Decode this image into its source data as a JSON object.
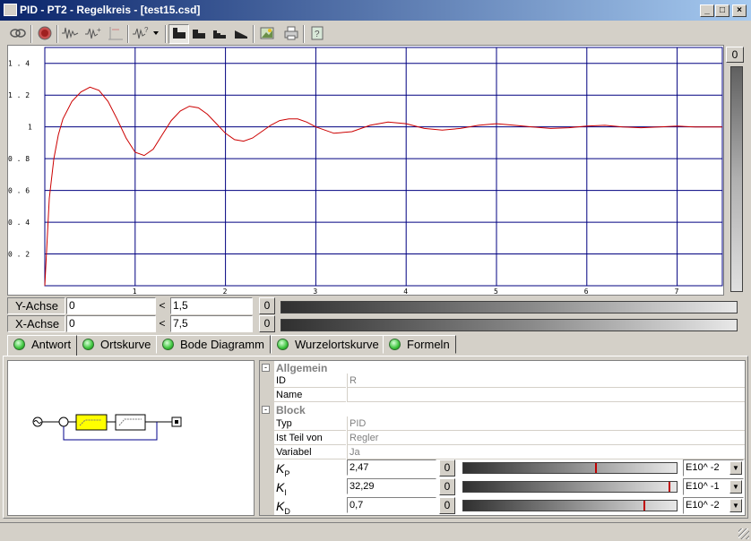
{
  "window": {
    "title": "PID - PT2 - Regelkreis - [test15.csd]",
    "buttons": [
      "_",
      "□",
      "×"
    ]
  },
  "toolbar": {
    "icons": [
      "link-icon",
      "record-icon",
      "signal-icon",
      "signal-add-icon",
      "marker-icon",
      "signal-select-icon",
      "step-1-icon",
      "step-2-icon",
      "step-3-icon",
      "step-4-icon",
      "image-icon",
      "print-icon",
      "help-icon"
    ]
  },
  "chart_data": {
    "type": "line",
    "title": "",
    "xlabel": "",
    "ylabel": "",
    "xlim": [
      0,
      7.5
    ],
    "ylim": [
      0,
      1.5
    ],
    "x_ticks": [
      "1",
      "2",
      "3",
      "4",
      "5",
      "6",
      "7"
    ],
    "y_ticks": [
      "0.2",
      "0.4",
      "0.6",
      "0.8",
      "1",
      "1.2",
      "1.4"
    ],
    "y_tick_labels": [
      "0 . 2",
      "0 . 4",
      "0 . 6",
      "0 . 8",
      "1",
      "1 . 2",
      "1 . 4"
    ],
    "grid": true,
    "series": [
      {
        "color": "#cc0000",
        "x": [
          0,
          0.05,
          0.1,
          0.15,
          0.2,
          0.3,
          0.4,
          0.5,
          0.6,
          0.7,
          0.8,
          0.9,
          1.0,
          1.1,
          1.2,
          1.3,
          1.4,
          1.5,
          1.6,
          1.7,
          1.8,
          1.9,
          2.0,
          2.1,
          2.2,
          2.3,
          2.4,
          2.5,
          2.6,
          2.7,
          2.8,
          2.9,
          3.0,
          3.2,
          3.4,
          3.6,
          3.8,
          4.0,
          4.2,
          4.4,
          4.6,
          4.8,
          5.0,
          5.2,
          5.4,
          5.6,
          5.8,
          6.0,
          6.2,
          6.4,
          6.6,
          6.8,
          7.0,
          7.2,
          7.5
        ],
        "y": [
          0,
          0.55,
          0.8,
          0.95,
          1.05,
          1.16,
          1.22,
          1.25,
          1.23,
          1.16,
          1.05,
          0.93,
          0.84,
          0.82,
          0.86,
          0.95,
          1.04,
          1.1,
          1.13,
          1.12,
          1.08,
          1.02,
          0.96,
          0.92,
          0.91,
          0.93,
          0.97,
          1.01,
          1.04,
          1.05,
          1.05,
          1.03,
          1.0,
          0.96,
          0.97,
          1.01,
          1.03,
          1.02,
          0.99,
          0.98,
          0.99,
          1.01,
          1.02,
          1.01,
          1.0,
          0.99,
          0.995,
          1.005,
          1.01,
          1.0,
          0.995,
          1.0,
          1.005,
          1.0,
          1.0
        ]
      }
    ]
  },
  "vscale": {
    "value": "0",
    "level": 1.0
  },
  "axes": {
    "y": {
      "label": "Y-Achse",
      "min": "0",
      "lt": "<",
      "max": "1,5",
      "zero": "0"
    },
    "x": {
      "label": "X-Achse",
      "min": "0",
      "lt": "<",
      "max": "7,5",
      "zero": "0"
    }
  },
  "tabs": [
    {
      "label": "Antwort",
      "active": true
    },
    {
      "label": "Ortskurve",
      "active": false
    },
    {
      "label": "Bode Diagramm",
      "active": false
    },
    {
      "label": "Wurzelortskurve",
      "active": false
    },
    {
      "label": "Formeln",
      "active": false
    }
  ],
  "properties": {
    "cat_general": "Allgemein",
    "cat_block": "Block",
    "toggle": "-",
    "id_label": "ID",
    "id_value": "R",
    "name_label": "Name",
    "name_value": "",
    "typ_label": "Typ",
    "typ_value": "PID",
    "part_label": "Ist Teil von",
    "part_value": "Regler",
    "var_label": "Variabel",
    "var_value": "Ja"
  },
  "params": [
    {
      "sym": "K",
      "sub": "P",
      "value": "2,47",
      "zero": "0",
      "exp": "E10^ -2",
      "slider": 0.63
    },
    {
      "sym": "K",
      "sub": "I",
      "value": "32,29",
      "zero": "0",
      "exp": "E10^ -1",
      "slider": 0.98
    },
    {
      "sym": "K",
      "sub": "D",
      "value": "0,7",
      "zero": "0",
      "exp": "E10^ -2",
      "slider": 0.86
    }
  ],
  "colors": {
    "curve": "#cc0000",
    "grid": "#000080",
    "block_highlight": "#ffff00"
  }
}
